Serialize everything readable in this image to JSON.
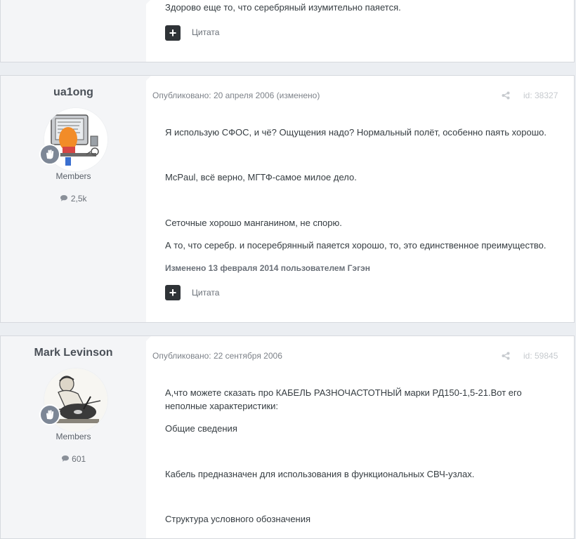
{
  "posts": [
    {
      "paragraphs": [
        "Здорово еще то, что серебряный изумительно паяется."
      ],
      "quote_label": "Цитата",
      "plus_label": "+"
    },
    {
      "author": "ua1ong",
      "group": "Members",
      "post_count": "2,5k",
      "published": "Опубликовано: 20 апреля 2006 (изменено)",
      "post_id": "id: 38327",
      "paragraphs": [
        "Я использую СФОС, и чё? Ощущения надо? Нормальный полёт, особенно паять хорошо.",
        "McPaul, всё верно, МГТФ-самое милое дело.",
        "Сеточные хорошо манганином, не спорю.",
        "А то, что серебр. и посеребрянный паяется хорошо, то, это единственное преимущество."
      ],
      "edited_note": "Изменено 13 февраля 2014 пользователем Гэгэн",
      "quote_label": "Цитата",
      "plus_label": "+"
    },
    {
      "author": "Mark Levinson",
      "group": "Members",
      "post_count": "601",
      "published": "Опубликовано: 22 сентября 2006",
      "post_id": "id: 59845",
      "paragraphs": [
        "А,что можете сказать про КАБЕЛЬ РАЗНОЧАСТОТНЫЙ марки РД150-1,5-21.Вот его",
        "неполные характеристики:",
        "Общие сведения",
        "Кабель предназначен для использования в функциональных СВЧ-узлах.",
        "Структура условного обозначения"
      ]
    }
  ],
  "colors": {
    "page_bg": "#ebeef2",
    "author_panel_bg": "#f4f5f7",
    "button_dark": "#2f3337",
    "rank_badge": "#7d8796"
  },
  "icons": [
    "share-icon",
    "comment-icon",
    "rank-hand-icon",
    "plus-icon"
  ]
}
